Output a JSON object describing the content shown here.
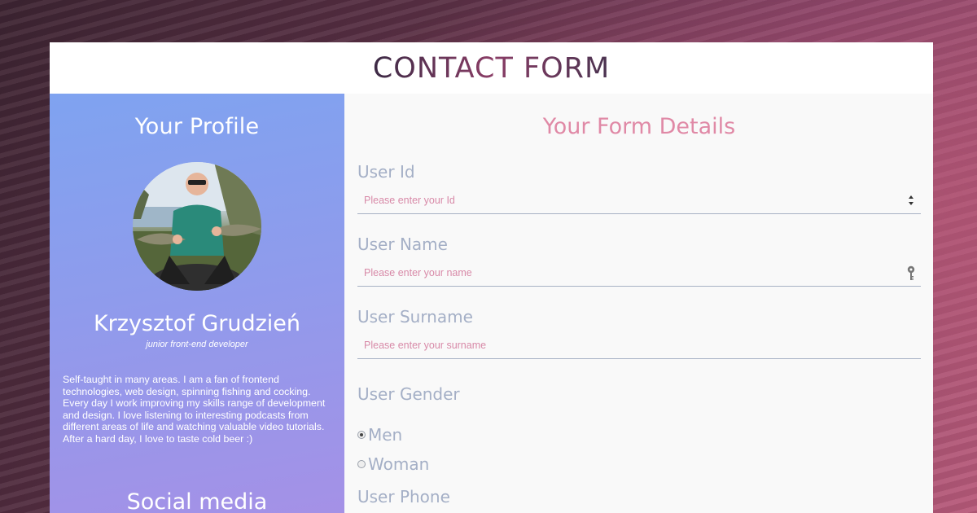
{
  "header": {
    "title": "CONTACT FORM"
  },
  "profile": {
    "heading": "Your Profile",
    "name": "Krzysztof Grudzień",
    "role": "junior front-end developer",
    "bio": "Self-taught in many areas. I am a fan of frontend technologies, web design, spinning fishing and cocking. Every day I work improving my skills range of development and design. I love listening to interesting podcasts from different areas of life and watching valuable video tutorials. After a hard day, I love to taste cold beer :)",
    "social_heading": "Social media"
  },
  "form": {
    "heading": "Your Form Details",
    "user_id": {
      "label": "User Id",
      "placeholder": "Please enter your Id"
    },
    "user_name": {
      "label": "User Name",
      "placeholder": "Please enter your name"
    },
    "user_surname": {
      "label": "User Surname",
      "placeholder": "Please enter your surname"
    },
    "user_gender": {
      "label": "User Gender",
      "options": [
        {
          "label": "Men",
          "checked": true
        },
        {
          "label": "Woman",
          "checked": false
        }
      ]
    },
    "user_phone": {
      "label": "User Phone"
    }
  },
  "colors": {
    "accent": "#e089a6",
    "label": "#a4afc6",
    "profile_gradient_start": "#7fa3f0",
    "profile_gradient_end": "#a690e6"
  },
  "icons": [
    "number-spinner-icon",
    "key-icon",
    "radio-icon"
  ]
}
